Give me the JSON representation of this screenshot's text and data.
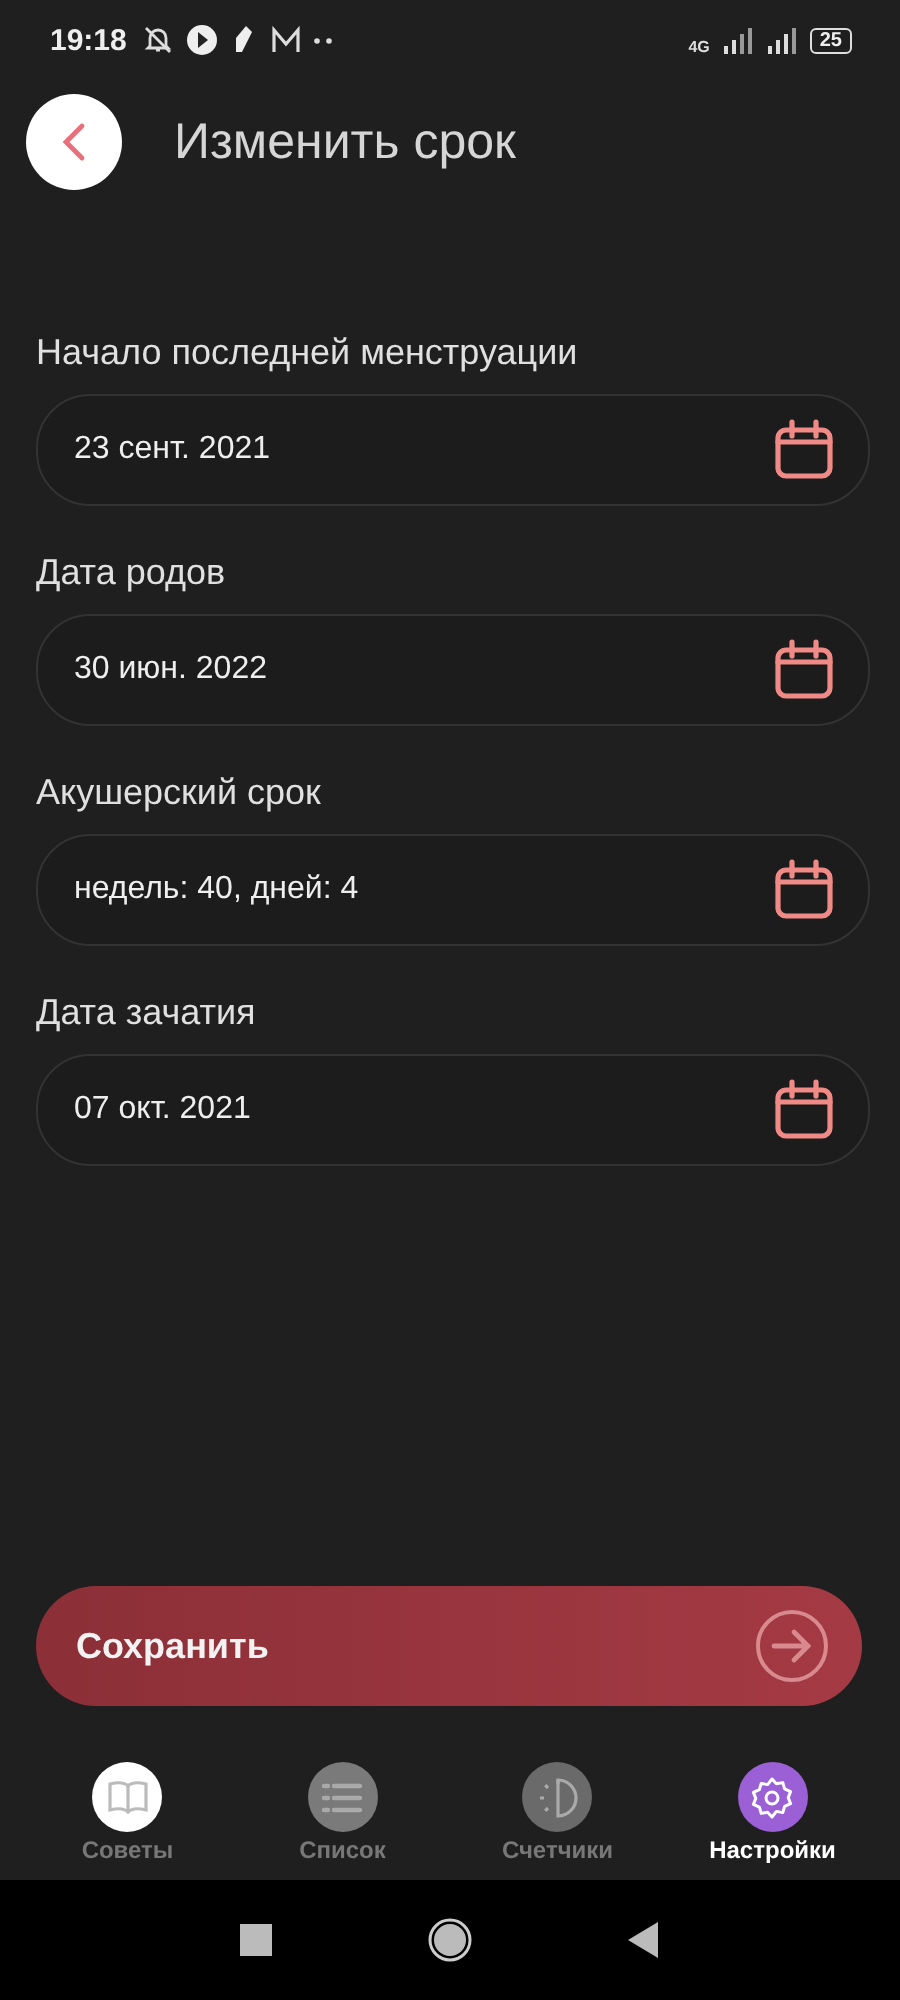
{
  "status_bar": {
    "time": "19:18",
    "battery": "25",
    "network": "4G"
  },
  "header": {
    "title": "Изменить срок"
  },
  "fields": [
    {
      "label": "Начало последней менструации",
      "value": "23 сент. 2021"
    },
    {
      "label": "Дата родов",
      "value": "30 июн. 2022"
    },
    {
      "label": "Акушерский срок",
      "value": "недель: 40, дней: 4"
    },
    {
      "label": "Дата зачатия",
      "value": "07 окт. 2021"
    }
  ],
  "save_button": {
    "label": "Сохранить"
  },
  "tabs": [
    {
      "label": "Советы",
      "kind": "book",
      "color": "#ffffff",
      "selected": false
    },
    {
      "label": "Список",
      "kind": "list",
      "color": "#7a7a7a",
      "selected": false
    },
    {
      "label": "Счетчики",
      "kind": "timer",
      "color": "#6a6a6a",
      "selected": false
    },
    {
      "label": "Настройки",
      "kind": "gear",
      "color": "#9b5fd6",
      "selected": true
    }
  ]
}
